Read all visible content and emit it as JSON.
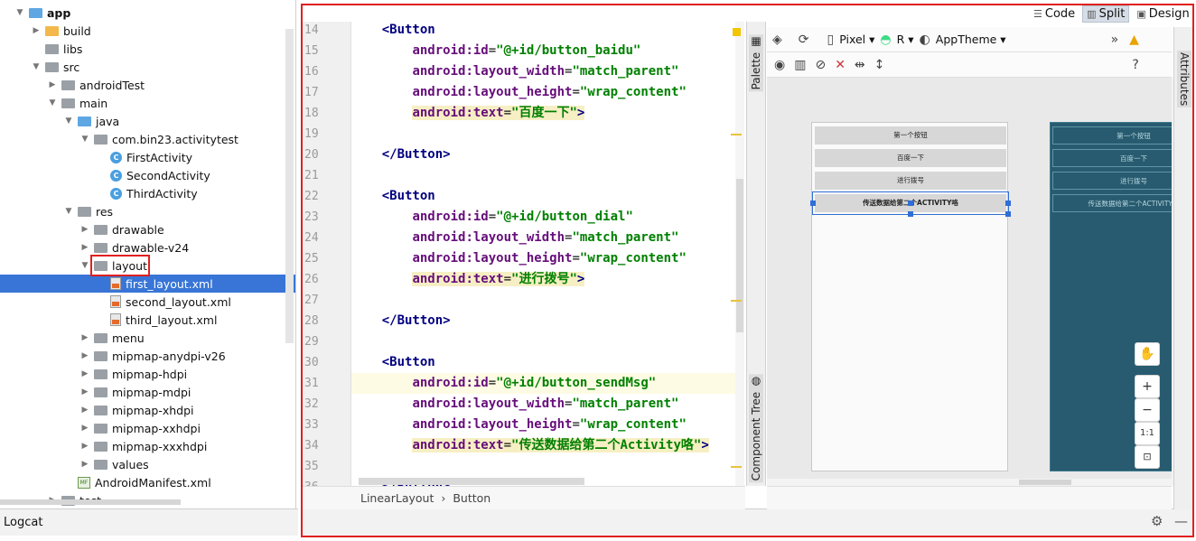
{
  "project_tree": {
    "items": [
      {
        "label": "app",
        "depth": 0,
        "arrow": "▼",
        "icon": "module-icon",
        "bold": true
      },
      {
        "label": "build",
        "depth": 1,
        "arrow": "▶",
        "icon": "folder-build-icon"
      },
      {
        "label": "libs",
        "depth": 1,
        "arrow": "",
        "icon": "folder-icon"
      },
      {
        "label": "src",
        "depth": 1,
        "arrow": "▼",
        "icon": "folder-icon"
      },
      {
        "label": "androidTest",
        "depth": 2,
        "arrow": "▶",
        "icon": "folder-icon"
      },
      {
        "label": "main",
        "depth": 2,
        "arrow": "▼",
        "icon": "folder-icon"
      },
      {
        "label": "java",
        "depth": 3,
        "arrow": "▼",
        "icon": "folder-source-icon"
      },
      {
        "label": "com.bin23.activitytest",
        "depth": 4,
        "arrow": "▼",
        "icon": "package-icon"
      },
      {
        "label": "FirstActivity",
        "depth": 5,
        "arrow": "",
        "icon": "class-icon"
      },
      {
        "label": "SecondActivity",
        "depth": 5,
        "arrow": "",
        "icon": "class-icon"
      },
      {
        "label": "ThirdActivity",
        "depth": 5,
        "arrow": "",
        "icon": "class-icon"
      },
      {
        "label": "res",
        "depth": 3,
        "arrow": "▼",
        "icon": "folder-res-icon"
      },
      {
        "label": "drawable",
        "depth": 4,
        "arrow": "▶",
        "icon": "folder-icon"
      },
      {
        "label": "drawable-v24",
        "depth": 4,
        "arrow": "▶",
        "icon": "folder-icon"
      },
      {
        "label": "layout",
        "depth": 4,
        "arrow": "▼",
        "icon": "folder-icon"
      },
      {
        "label": "first_layout.xml",
        "depth": 5,
        "arrow": "",
        "icon": "xml-file-icon",
        "selected": true
      },
      {
        "label": "second_layout.xml",
        "depth": 5,
        "arrow": "",
        "icon": "xml-file-icon"
      },
      {
        "label": "third_layout.xml",
        "depth": 5,
        "arrow": "",
        "icon": "xml-file-icon"
      },
      {
        "label": "menu",
        "depth": 4,
        "arrow": "▶",
        "icon": "folder-icon"
      },
      {
        "label": "mipmap-anydpi-v26",
        "depth": 4,
        "arrow": "▶",
        "icon": "folder-icon"
      },
      {
        "label": "mipmap-hdpi",
        "depth": 4,
        "arrow": "▶",
        "icon": "folder-icon"
      },
      {
        "label": "mipmap-mdpi",
        "depth": 4,
        "arrow": "▶",
        "icon": "folder-icon"
      },
      {
        "label": "mipmap-xhdpi",
        "depth": 4,
        "arrow": "▶",
        "icon": "folder-icon"
      },
      {
        "label": "mipmap-xxhdpi",
        "depth": 4,
        "arrow": "▶",
        "icon": "folder-icon"
      },
      {
        "label": "mipmap-xxxhdpi",
        "depth": 4,
        "arrow": "▶",
        "icon": "folder-icon"
      },
      {
        "label": "values",
        "depth": 4,
        "arrow": "▶",
        "icon": "folder-icon"
      },
      {
        "label": "AndroidManifest.xml",
        "depth": 3,
        "arrow": "",
        "icon": "manifest-file-icon"
      },
      {
        "label": "test",
        "depth": 2,
        "arrow": "▶",
        "icon": "folder-icon"
      }
    ]
  },
  "bottom": {
    "logcat_label": "Logcat"
  },
  "view_modes": [
    {
      "label": "Code",
      "icon": "code-view-icon",
      "selected": false
    },
    {
      "label": "Split",
      "icon": "split-view-icon",
      "selected": true
    },
    {
      "label": "Design",
      "icon": "design-view-icon",
      "selected": false
    }
  ],
  "editor": {
    "lines": [
      {
        "num": "14",
        "parts": [
          {
            "t": "    ",
            "c": ""
          },
          {
            "t": "<Button",
            "c": "tag"
          }
        ]
      },
      {
        "num": "15",
        "parts": [
          {
            "t": "        ",
            "c": ""
          },
          {
            "t": "android:id",
            "c": "attr"
          },
          {
            "t": "=",
            "c": ""
          },
          {
            "t": "\"@+id/button_baidu\"",
            "c": "val"
          }
        ]
      },
      {
        "num": "16",
        "parts": [
          {
            "t": "        ",
            "c": ""
          },
          {
            "t": "android:layout_width",
            "c": "attr"
          },
          {
            "t": "=",
            "c": ""
          },
          {
            "t": "\"match_parent\"",
            "c": "val"
          }
        ]
      },
      {
        "num": "17",
        "parts": [
          {
            "t": "        ",
            "c": ""
          },
          {
            "t": "android:layout_height",
            "c": "attr"
          },
          {
            "t": "=",
            "c": ""
          },
          {
            "t": "\"wrap_content\"",
            "c": "val"
          }
        ]
      },
      {
        "num": "18",
        "parts": [
          {
            "t": "        ",
            "c": ""
          },
          {
            "t": "android:text",
            "c": "attr hl"
          },
          {
            "t": "=",
            "c": "hl"
          },
          {
            "t": "\"百度一下\"",
            "c": "val hl"
          },
          {
            "t": ">",
            "c": "tag hl"
          }
        ]
      },
      {
        "num": "19",
        "parts": []
      },
      {
        "num": "20",
        "parts": [
          {
            "t": "    ",
            "c": ""
          },
          {
            "t": "</Button>",
            "c": "tag"
          }
        ]
      },
      {
        "num": "21",
        "parts": []
      },
      {
        "num": "22",
        "parts": [
          {
            "t": "    ",
            "c": ""
          },
          {
            "t": "<Button",
            "c": "tag"
          }
        ]
      },
      {
        "num": "23",
        "parts": [
          {
            "t": "        ",
            "c": ""
          },
          {
            "t": "android:id",
            "c": "attr"
          },
          {
            "t": "=",
            "c": ""
          },
          {
            "t": "\"@+id/button_dial\"",
            "c": "val"
          }
        ]
      },
      {
        "num": "24",
        "parts": [
          {
            "t": "        ",
            "c": ""
          },
          {
            "t": "android:layout_width",
            "c": "attr"
          },
          {
            "t": "=",
            "c": ""
          },
          {
            "t": "\"match_parent\"",
            "c": "val"
          }
        ]
      },
      {
        "num": "25",
        "parts": [
          {
            "t": "        ",
            "c": ""
          },
          {
            "t": "android:layout_height",
            "c": "attr"
          },
          {
            "t": "=",
            "c": ""
          },
          {
            "t": "\"wrap_content\"",
            "c": "val"
          }
        ]
      },
      {
        "num": "26",
        "parts": [
          {
            "t": "        ",
            "c": ""
          },
          {
            "t": "android:text",
            "c": "attr hl"
          },
          {
            "t": "=",
            "c": "hl"
          },
          {
            "t": "\"进行拨号\"",
            "c": "val hl"
          },
          {
            "t": ">",
            "c": "tag hl"
          }
        ]
      },
      {
        "num": "27",
        "parts": []
      },
      {
        "num": "28",
        "parts": [
          {
            "t": "    ",
            "c": ""
          },
          {
            "t": "</Button>",
            "c": "tag"
          }
        ]
      },
      {
        "num": "29",
        "parts": []
      },
      {
        "num": "30",
        "parts": [
          {
            "t": "    ",
            "c": ""
          },
          {
            "t": "<Button",
            "c": "tag"
          }
        ]
      },
      {
        "num": "31",
        "parts": [
          {
            "t": "        ",
            "c": ""
          },
          {
            "t": "android:id",
            "c": "attr"
          },
          {
            "t": "=",
            "c": ""
          },
          {
            "t": "\"@+id/button_sendMsg\"",
            "c": "val"
          }
        ],
        "current": true
      },
      {
        "num": "32",
        "parts": [
          {
            "t": "        ",
            "c": ""
          },
          {
            "t": "android:layout_width",
            "c": "attr"
          },
          {
            "t": "=",
            "c": ""
          },
          {
            "t": "\"match_parent\"",
            "c": "val"
          }
        ]
      },
      {
        "num": "33",
        "parts": [
          {
            "t": "        ",
            "c": ""
          },
          {
            "t": "android:layout_height",
            "c": "attr"
          },
          {
            "t": "=",
            "c": ""
          },
          {
            "t": "\"wrap_content\"",
            "c": "val"
          }
        ]
      },
      {
        "num": "34",
        "parts": [
          {
            "t": "        ",
            "c": ""
          },
          {
            "t": "android:text",
            "c": "attr hl"
          },
          {
            "t": "=",
            "c": "hl"
          },
          {
            "t": "\"传送数据给第二个Activity咯\"",
            "c": "val hl"
          },
          {
            "t": ">",
            "c": "tag hl"
          }
        ]
      },
      {
        "num": "35",
        "parts": []
      },
      {
        "num": "36",
        "parts": [
          {
            "t": "    ",
            "c": ""
          },
          {
            "t": "</Button>",
            "c": "tag"
          }
        ]
      }
    ],
    "breadcrumb": [
      "LinearLayout",
      "Button"
    ]
  },
  "side_tabs": {
    "palette": "Palette",
    "component_tree": "Component Tree",
    "attributes": "Attributes"
  },
  "design_toolbar": {
    "device": "Pixel",
    "api": "R",
    "theme": "AppTheme"
  },
  "preview": {
    "buttons": [
      "第一个按钮",
      "百度一下",
      "进行拨号",
      "传送数据给第二个ACTIVITY咯"
    ],
    "zoom_controls": [
      "+",
      "−",
      "1:1"
    ]
  }
}
